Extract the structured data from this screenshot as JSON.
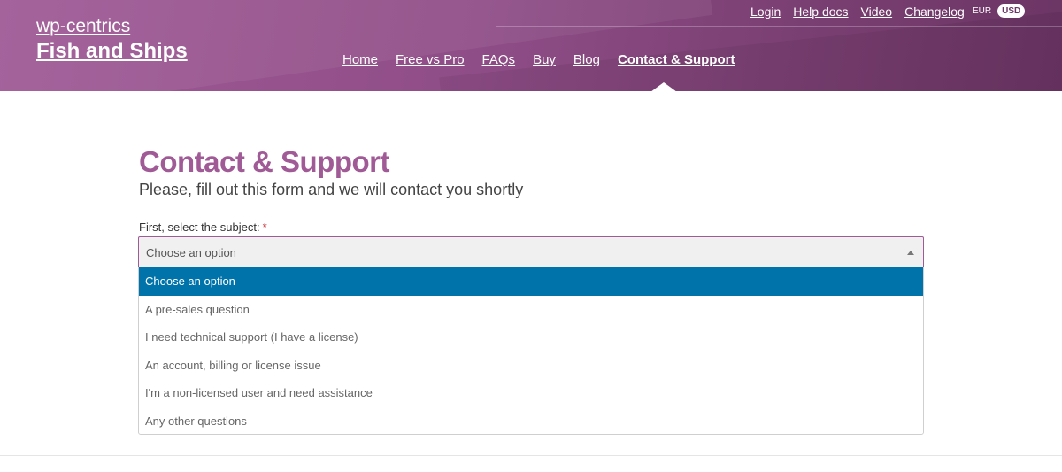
{
  "brand": {
    "small": "wp-centrics",
    "big": "Fish and Ships"
  },
  "top_links": [
    "Login",
    "Help docs",
    "Video",
    "Changelog"
  ],
  "currency": {
    "eur": "EUR",
    "usd": "USD"
  },
  "nav": [
    "Home",
    "Free vs Pro",
    "FAQs",
    "Buy",
    "Blog",
    "Contact & Support"
  ],
  "page": {
    "title": "Contact & Support",
    "subtitle": "Please, fill out this form and we will contact you shortly"
  },
  "form": {
    "label": "First, select the subject:",
    "required_mark": "*",
    "selected": "Choose an option",
    "options": [
      "Choose an option",
      "A pre-sales question",
      "I need technical support (I have a license)",
      "An account, billing or license issue",
      "I'm a non-licensed user and need assistance",
      "Any other questions"
    ]
  },
  "colors": {
    "brand_purple": "#a05a96",
    "highlight_blue": "#0073aa"
  }
}
